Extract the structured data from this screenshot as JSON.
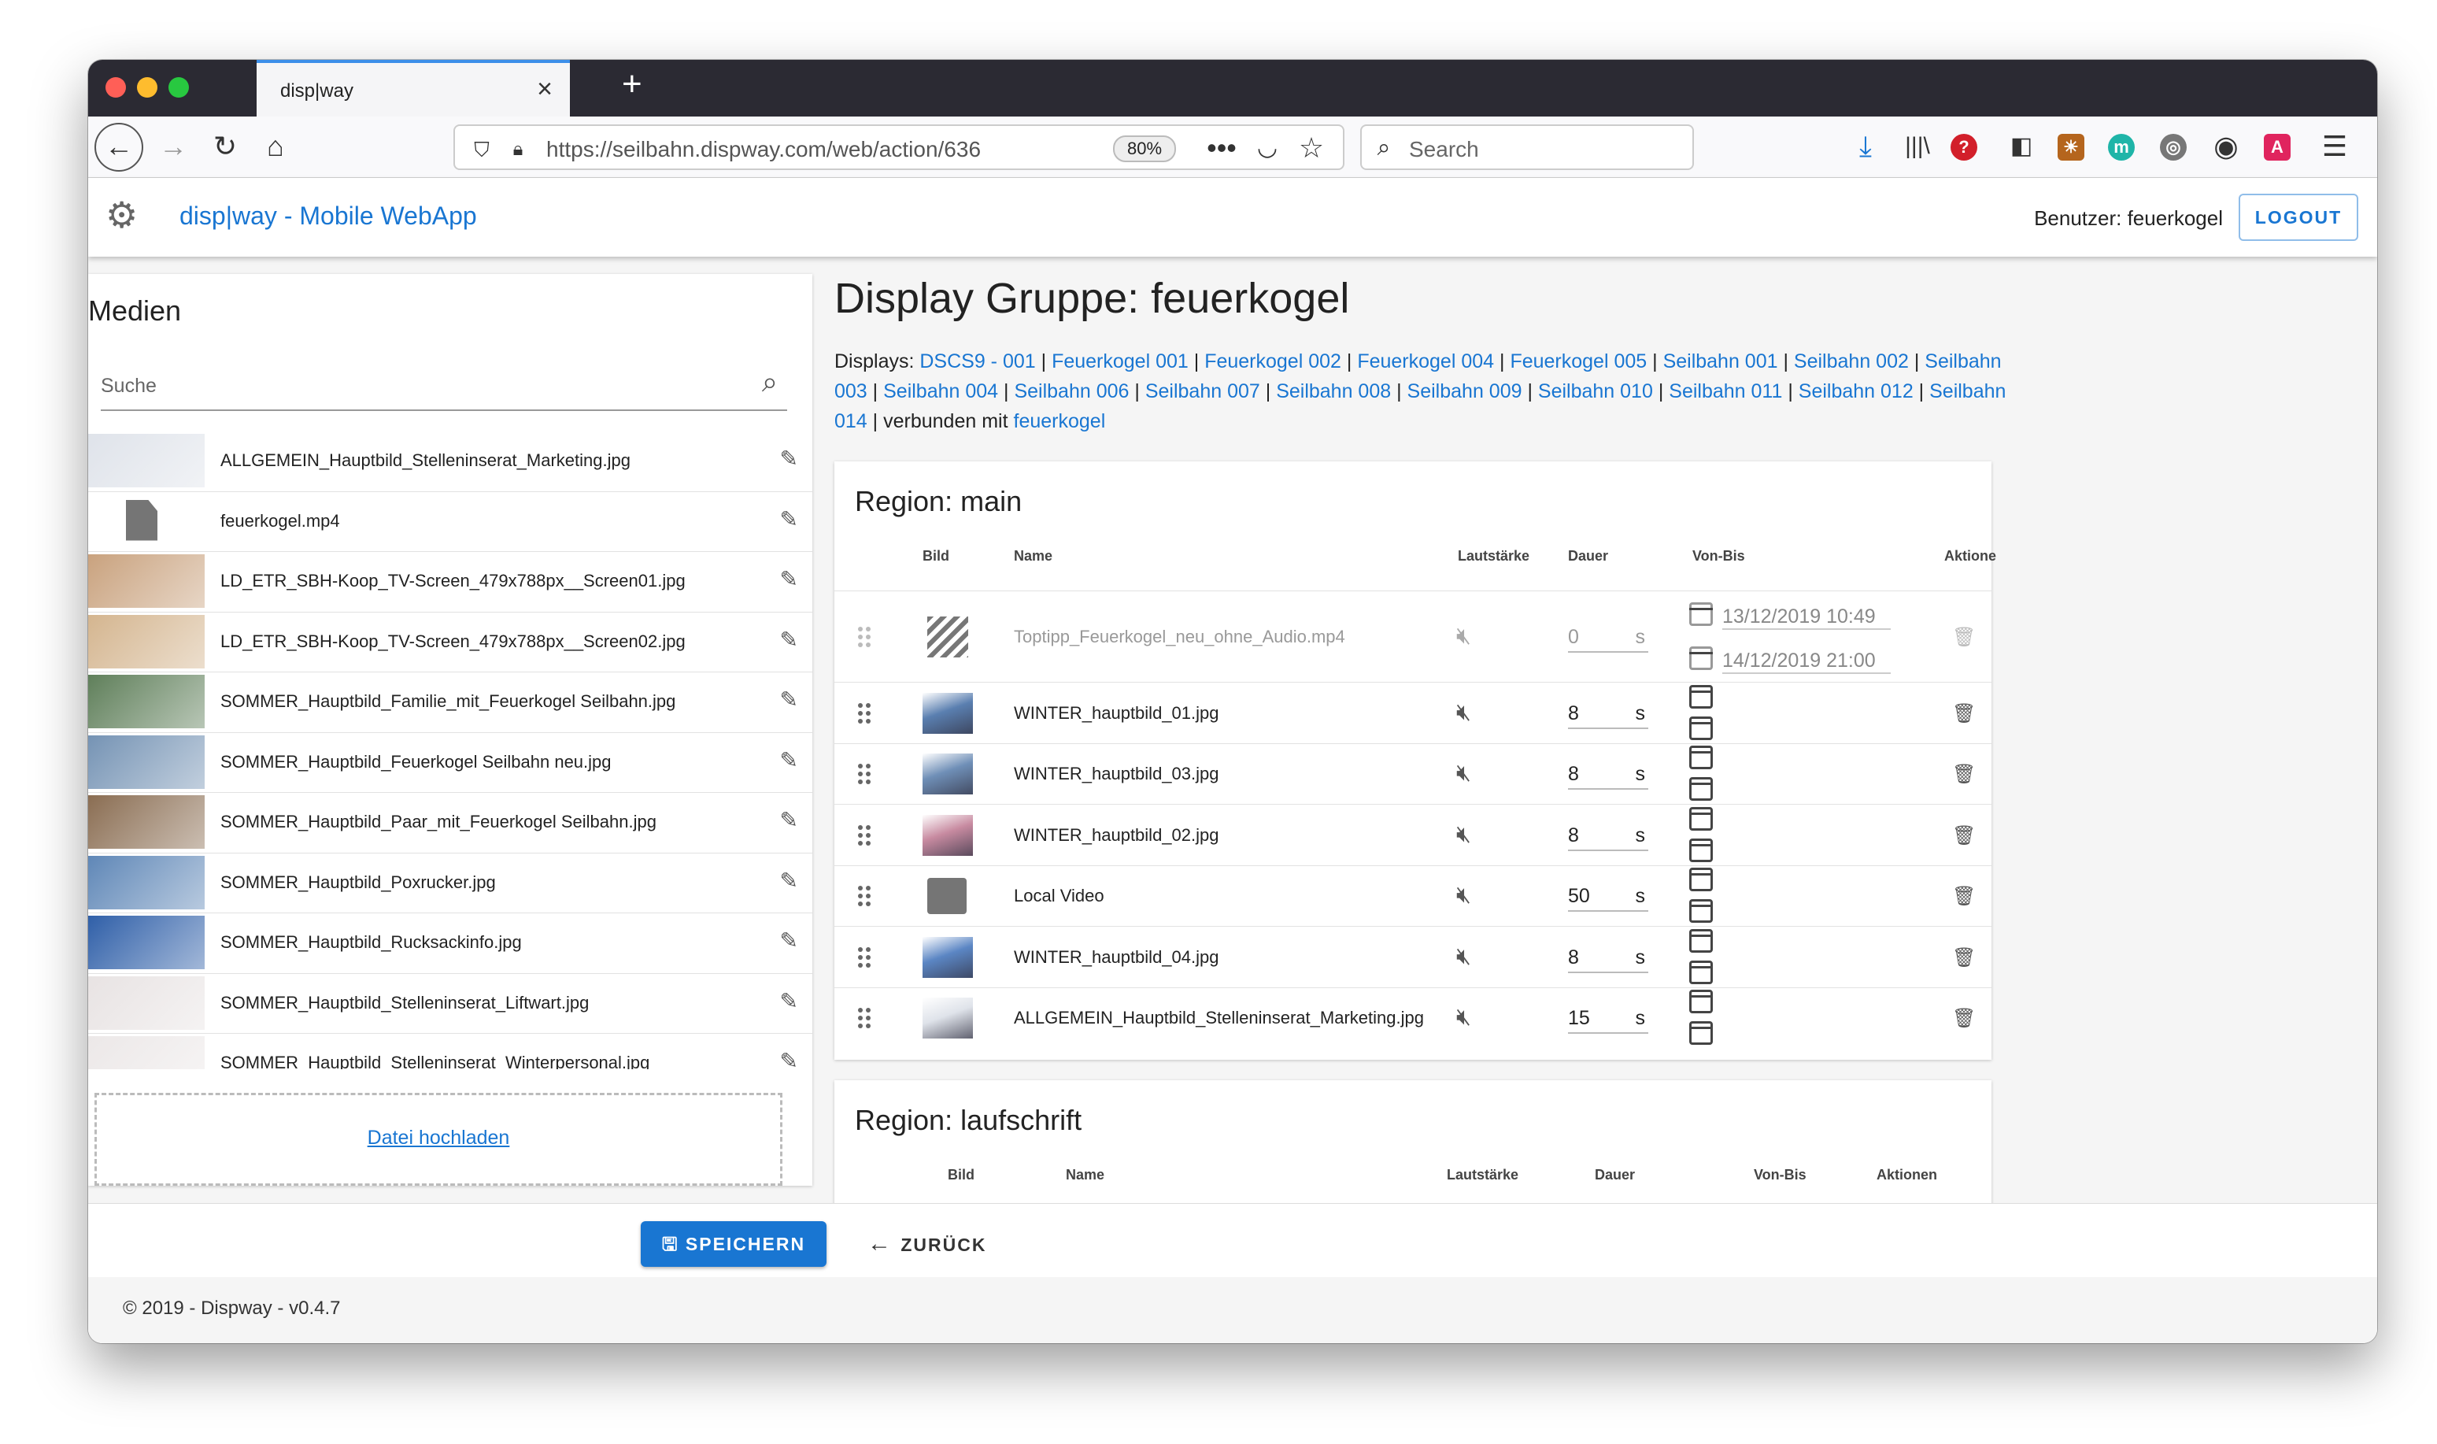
{
  "browser": {
    "tab_title": "disp|way",
    "url": "https://seilbahn.dispway.com/web/action/636",
    "zoom": "80%",
    "search_placeholder": "Search"
  },
  "app": {
    "title": "disp|way - Mobile WebApp",
    "user": "Benutzer: feuerkogel",
    "logout": "LOGOUT"
  },
  "media": {
    "heading": "Medien",
    "search_placeholder": "Suche",
    "items": [
      {
        "name": "ALLGEMEIN_Hauptbild_Stelleninserat_Marketing.jpg",
        "thumb": "#dfe3ea"
      },
      {
        "name": "feuerkogel.mp4",
        "thumb": "file"
      },
      {
        "name": "LD_ETR_SBH-Koop_TV-Screen_479x788px__Screen01.jpg",
        "thumb": "#c9a27e"
      },
      {
        "name": "LD_ETR_SBH-Koop_TV-Screen_479x788px__Screen02.jpg",
        "thumb": "#d4b58f"
      },
      {
        "name": "SOMMER_Hauptbild_Familie_mit_Feuerkogel Seilbahn.jpg",
        "thumb": "#5f7f5a"
      },
      {
        "name": "SOMMER_Hauptbild_Feuerkogel Seilbahn neu.jpg",
        "thumb": "#7593b4"
      },
      {
        "name": "SOMMER_Hauptbild_Paar_mit_Feuerkogel Seilbahn.jpg",
        "thumb": "#8a6d52"
      },
      {
        "name": "SOMMER_Hauptbild_Poxrucker.jpg",
        "thumb": "#5f87b7"
      },
      {
        "name": "SOMMER_Hauptbild_Rucksackinfo.jpg",
        "thumb": "#2f5fa8"
      },
      {
        "name": "SOMMER_Hauptbild_Stelleninserat_Liftwart.jpg",
        "thumb": "#e8e3e3"
      },
      {
        "name": "SOMMER_Hauptbild_Stelleninserat_Winterpersonal.jpg",
        "thumb": "#ece8e8"
      }
    ],
    "upload": "Datei hochladen"
  },
  "main": {
    "title": "Display Gruppe: feuerkogel",
    "displays_label": "Displays:",
    "displays": [
      "DSCS9 - 001",
      "Feuerkogel 001",
      "Feuerkogel 002",
      "Feuerkogel 004",
      "Feuerkogel 005",
      "Seilbahn 001",
      "Seilbahn 002",
      "Seilbahn 003",
      "Seilbahn 004",
      "Seilbahn 006",
      "Seilbahn 007",
      "Seilbahn 008",
      "Seilbahn 009",
      "Seilbahn 010",
      "Seilbahn 011",
      "Seilbahn 012",
      "Seilbahn 014"
    ],
    "connected_label": "verbunden mit",
    "connected": "feuerkogel"
  },
  "region_main": {
    "title": "Region: main",
    "headers": {
      "bild": "Bild",
      "name": "Name",
      "volume": "Lautstärke",
      "duration": "Dauer",
      "range": "Von-Bis",
      "actions": "Aktione"
    },
    "rows": [
      {
        "name": "Toptipp_Feuerkogel_neu_ohne_Audio.mp4",
        "duration": "0",
        "unit": "s",
        "from": "13/12/2019  10:49",
        "to": "14/12/2019  21:00",
        "thumb": "striped",
        "disabled": true
      },
      {
        "name": "WINTER_hauptbild_01.jpg",
        "duration": "8",
        "unit": "s",
        "thumb": "#5a7fb0"
      },
      {
        "name": "WINTER_hauptbild_03.jpg",
        "duration": "8",
        "unit": "s",
        "thumb": "#6f8fb7"
      },
      {
        "name": "WINTER_hauptbild_02.jpg",
        "duration": "8",
        "unit": "s",
        "thumb": "#c78aa0"
      },
      {
        "name": "Local Video",
        "duration": "50",
        "unit": "s",
        "thumb": "image-icon"
      },
      {
        "name": "WINTER_hauptbild_04.jpg",
        "duration": "8",
        "unit": "s",
        "thumb": "#5b86c4"
      },
      {
        "name": "ALLGEMEIN_Hauptbild_Stelleninserat_Marketing.jpg",
        "duration": "15",
        "unit": "s",
        "thumb": "#dfe3ea"
      }
    ]
  },
  "region_lauf": {
    "title": "Region: laufschrift",
    "headers": {
      "bild": "Bild",
      "name": "Name",
      "volume": "Lautstärke",
      "duration": "Dauer",
      "range": "Von-Bis",
      "actions": "Aktionen"
    }
  },
  "actions": {
    "save": "SPEICHERN",
    "back": "ZURÜCK"
  },
  "footer": "© 2019 - Dispway - v0.4.7"
}
